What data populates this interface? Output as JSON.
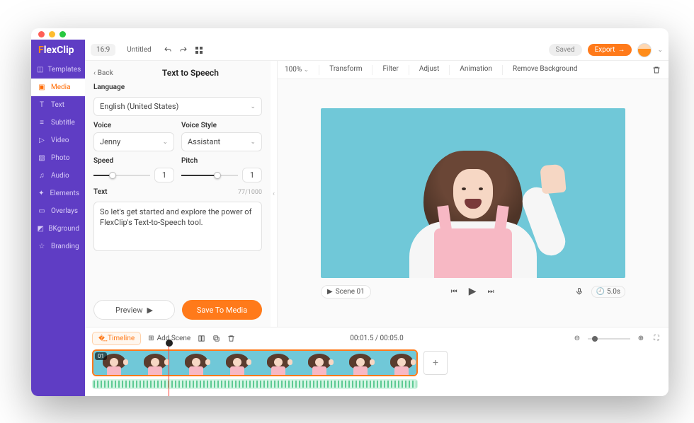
{
  "brand": {
    "prefix": "F",
    "rest": "lexClip"
  },
  "topbar": {
    "aspect": "16:9",
    "title": "Untitled",
    "saved": "Saved",
    "export": "Export"
  },
  "sidebar": [
    {
      "id": "templates",
      "label": "Templates",
      "icon": "◫"
    },
    {
      "id": "media",
      "label": "Media",
      "icon": "▣"
    },
    {
      "id": "text",
      "label": "Text",
      "icon": "T"
    },
    {
      "id": "subtitle",
      "label": "Subtitle",
      "icon": "≡"
    },
    {
      "id": "video",
      "label": "Video",
      "icon": "▷"
    },
    {
      "id": "photo",
      "label": "Photo",
      "icon": "▧"
    },
    {
      "id": "audio",
      "label": "Audio",
      "icon": "♫"
    },
    {
      "id": "elements",
      "label": "Elements",
      "icon": "✦"
    },
    {
      "id": "overlays",
      "label": "Overlays",
      "icon": "▭"
    },
    {
      "id": "bkground",
      "label": "BKground",
      "icon": "◩"
    },
    {
      "id": "branding",
      "label": "Branding",
      "icon": "☆"
    }
  ],
  "sidebar_active": "media",
  "panel": {
    "back": "Back",
    "title": "Text to Speech",
    "language_label": "Language",
    "language_value": "English (United States)",
    "voice_label": "Voice",
    "voice_value": "Jenny",
    "style_label": "Voice Style",
    "style_value": "Assistant",
    "speed_label": "Speed",
    "speed_value": "1",
    "pitch_label": "Pitch",
    "pitch_value": "1",
    "text_label": "Text",
    "text_counter": "77/1000",
    "text_value": "So let's get started and explore the power of FlexClip's Text-to-Speech tool.",
    "preview": "Preview",
    "save": "Save To Media"
  },
  "canvas_toolbar": {
    "zoom": "100%",
    "items": [
      "Transform",
      "Filter",
      "Adjust",
      "Animation",
      "Remove Background"
    ]
  },
  "playback": {
    "scene_label": "Scene 01",
    "duration": "5.0s"
  },
  "timeline": {
    "tab": "Timeline",
    "add_scene": "Add Scene",
    "time": "00:01.5 / 00:05.0",
    "clip_index": "01",
    "thumb_count": 8
  }
}
